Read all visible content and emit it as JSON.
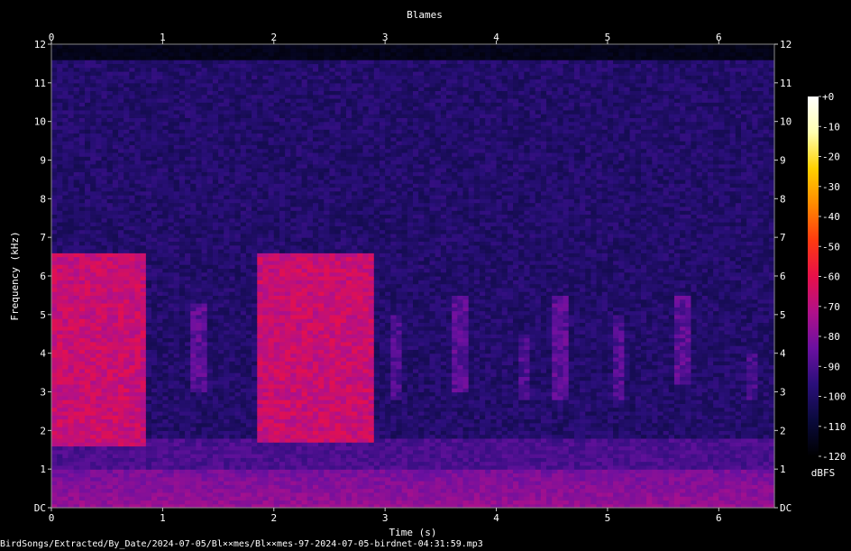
{
  "chart_data": {
    "type": "heatmap",
    "title": "Blames",
    "xlabel": "Time (s)",
    "ylabel": "Frequency (kHz)",
    "xlim": [
      0,
      6.5
    ],
    "ylim": [
      0,
      12
    ],
    "x_ticks": [
      "0",
      "1",
      "2",
      "3",
      "4",
      "5",
      "6"
    ],
    "y_ticks": [
      "DC",
      "1",
      "2",
      "3",
      "4",
      "5",
      "6",
      "7",
      "8",
      "9",
      "10",
      "11",
      "12"
    ],
    "colorbar": {
      "label": "dBFS",
      "range": [
        -120,
        0
      ],
      "ticks": [
        "+0",
        "-10",
        "-20",
        "-30",
        "-40",
        "-50",
        "-60",
        "-70",
        "-80",
        "-90",
        "-100",
        "-110",
        "-120"
      ],
      "stops": [
        "#000000",
        "#0a0a3c",
        "#2a0f7a",
        "#6a10a0",
        "#b0108a",
        "#e8104a",
        "#ff3a10",
        "#ff8a00",
        "#ffd000",
        "#ffffb0",
        "#ffffff"
      ]
    },
    "energy_regions_khz_s": [
      {
        "t0": 0.0,
        "t1": 0.85,
        "f0": 1.6,
        "f1": 6.6,
        "level_dbfs": -65
      },
      {
        "t0": 1.25,
        "t1": 1.4,
        "f0": 3.0,
        "f1": 5.3,
        "level_dbfs": -85
      },
      {
        "t0": 1.85,
        "t1": 2.9,
        "f0": 1.7,
        "f1": 6.6,
        "level_dbfs": -65
      },
      {
        "t0": 3.05,
        "t1": 3.15,
        "f0": 2.8,
        "f1": 5.0,
        "level_dbfs": -88
      },
      {
        "t0": 3.6,
        "t1": 3.75,
        "f0": 3.0,
        "f1": 5.5,
        "level_dbfs": -85
      },
      {
        "t0": 4.2,
        "t1": 4.3,
        "f0": 2.8,
        "f1": 4.5,
        "level_dbfs": -88
      },
      {
        "t0": 4.5,
        "t1": 4.65,
        "f0": 2.8,
        "f1": 5.5,
        "level_dbfs": -85
      },
      {
        "t0": 5.05,
        "t1": 5.15,
        "f0": 2.8,
        "f1": 5.0,
        "level_dbfs": -87
      },
      {
        "t0": 5.6,
        "t1": 5.75,
        "f0": 3.2,
        "f1": 5.5,
        "level_dbfs": -85
      },
      {
        "t0": 6.25,
        "t1": 6.35,
        "f0": 2.8,
        "f1": 4.0,
        "level_dbfs": -88
      }
    ],
    "noise_floor_dbfs": -100,
    "low_band_dbfs": -80,
    "bandwidth_limit_khz": 11.6
  },
  "footer_path": "BirdSongs/Extracted/By_Date/2024-07-05/Bl××mes/Bl××mes-97-2024-07-05-birdnet-04:31:59.mp3"
}
